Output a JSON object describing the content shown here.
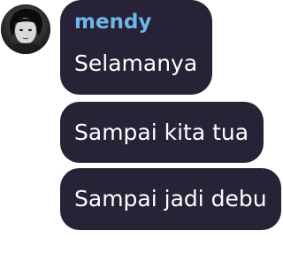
{
  "messages": [
    {
      "sender": "mendy",
      "text": "Selamanya"
    },
    {
      "text": "Sampai kita tua"
    },
    {
      "text": "Sampai jadi debu"
    }
  ],
  "colors": {
    "bubble": "#272236",
    "sender_name": "#6fb6ea",
    "text": "#ffffff",
    "background": "#ffffff"
  },
  "icons": {
    "avatar": "user-avatar"
  }
}
